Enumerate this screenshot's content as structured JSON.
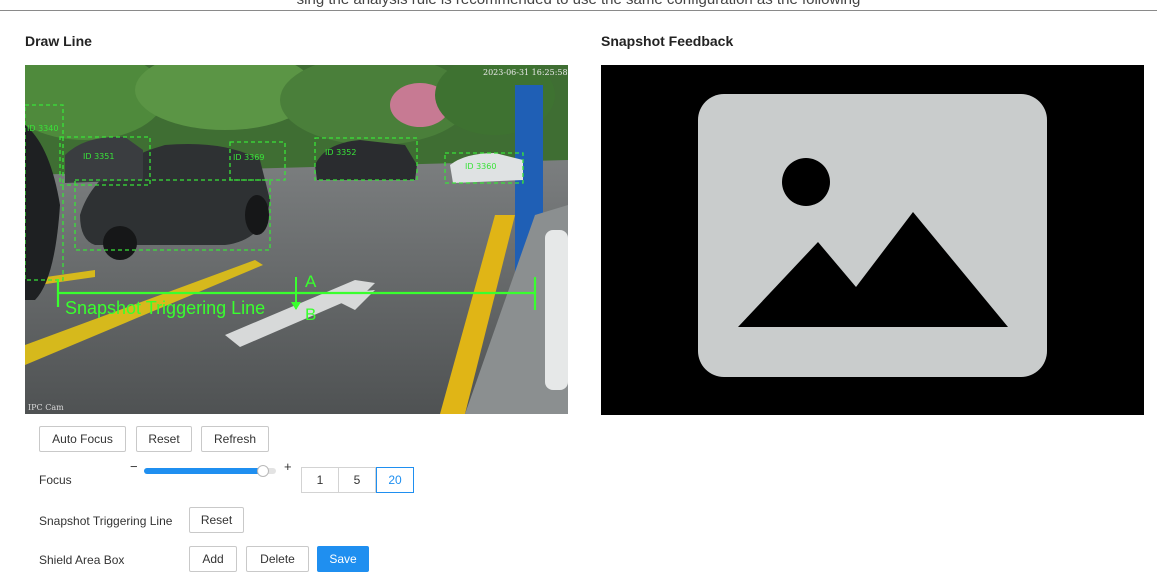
{
  "page": {
    "top_caption": "sing the analysis rule is recommended to use the same configuration as the following"
  },
  "draw_line": {
    "title": "Draw Line",
    "video": {
      "timestamp": "2023-06-31 16:25:58",
      "channel_label": "IPC Cam",
      "trigger_line_label": "Snapshot Triggering Line",
      "direction_a": "A",
      "direction_b": "B",
      "detections": [
        {
          "label": "ID 3340",
          "color": "#39e339"
        },
        {
          "label": "ID 3351",
          "color": "#39e339"
        },
        {
          "label": "ID 3369",
          "color": "#39e339"
        },
        {
          "label": "ID 3352",
          "color": "#39e339"
        },
        {
          "label": "ID 3360",
          "color": "#39e339"
        }
      ]
    },
    "buttons": {
      "auto_focus": "Auto Focus",
      "reset": "Reset",
      "refresh": "Refresh"
    },
    "focus": {
      "label": "Focus",
      "minus": "−",
      "plus": "+",
      "level": 0.9,
      "steps": [
        "1",
        "5",
        "20"
      ],
      "selected_step": "20"
    },
    "trigger_line_row": {
      "label": "Snapshot Triggering Line",
      "reset": "Reset"
    },
    "shield_row": {
      "label": "Shield Area Box",
      "add": "Add",
      "delete": "Delete",
      "save": "Save"
    }
  },
  "snapshot_feedback": {
    "title": "Snapshot Feedback",
    "placeholder_icon": "image-placeholder-icon"
  },
  "colors": {
    "accent": "#1f8ff0",
    "detection_green": "#39e339",
    "feedback_bg": "#000000",
    "placeholder_card": "#c9cccc"
  }
}
